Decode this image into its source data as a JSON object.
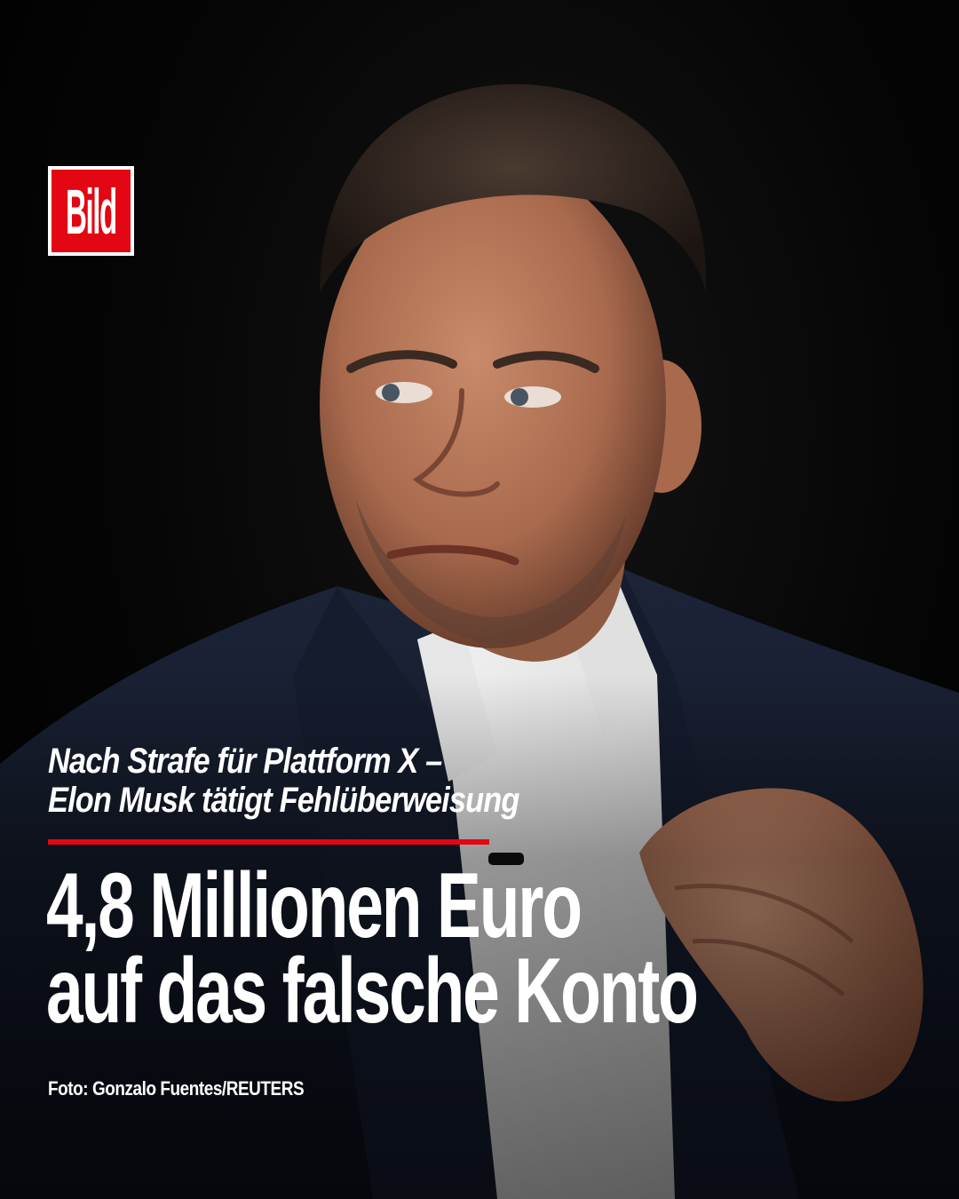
{
  "brand": {
    "logo_text": "Bild",
    "accent_color": "#e30613"
  },
  "article": {
    "kicker_line1": "Nach Strafe für Plattform X –",
    "kicker_line2": "Elon Musk tätigt Fehlüberweisung",
    "headline_line1": "4,8 Millionen Euro",
    "headline_line2": "auf das falsche Konto",
    "photo_credit": "Foto: Gonzalo Fuentes/REUTERS"
  }
}
